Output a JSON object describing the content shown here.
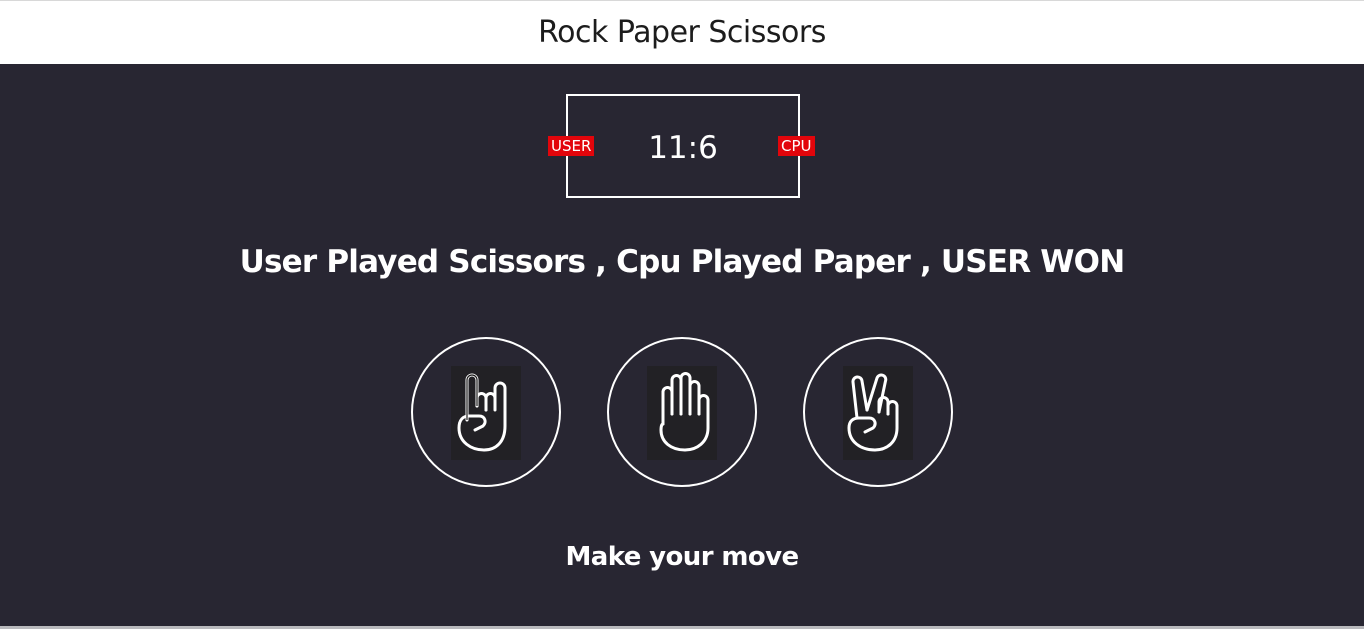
{
  "header": {
    "title": "Rock Paper Scissors"
  },
  "scoreboard": {
    "user_label": "USER",
    "cpu_label": "CPU",
    "score": "11:6"
  },
  "result": {
    "message": "User Played Scissors , Cpu Played Paper , USER WON"
  },
  "choices": [
    {
      "name": "rock",
      "icon": "rock-hand-icon"
    },
    {
      "name": "paper",
      "icon": "paper-hand-icon"
    },
    {
      "name": "scissors",
      "icon": "scissors-hand-icon"
    }
  ],
  "prompt": {
    "text": "Make your move"
  },
  "colors": {
    "background": "#282632",
    "header_background": "#ffffff",
    "badge": "#e2050b",
    "foreground": "#ffffff"
  }
}
